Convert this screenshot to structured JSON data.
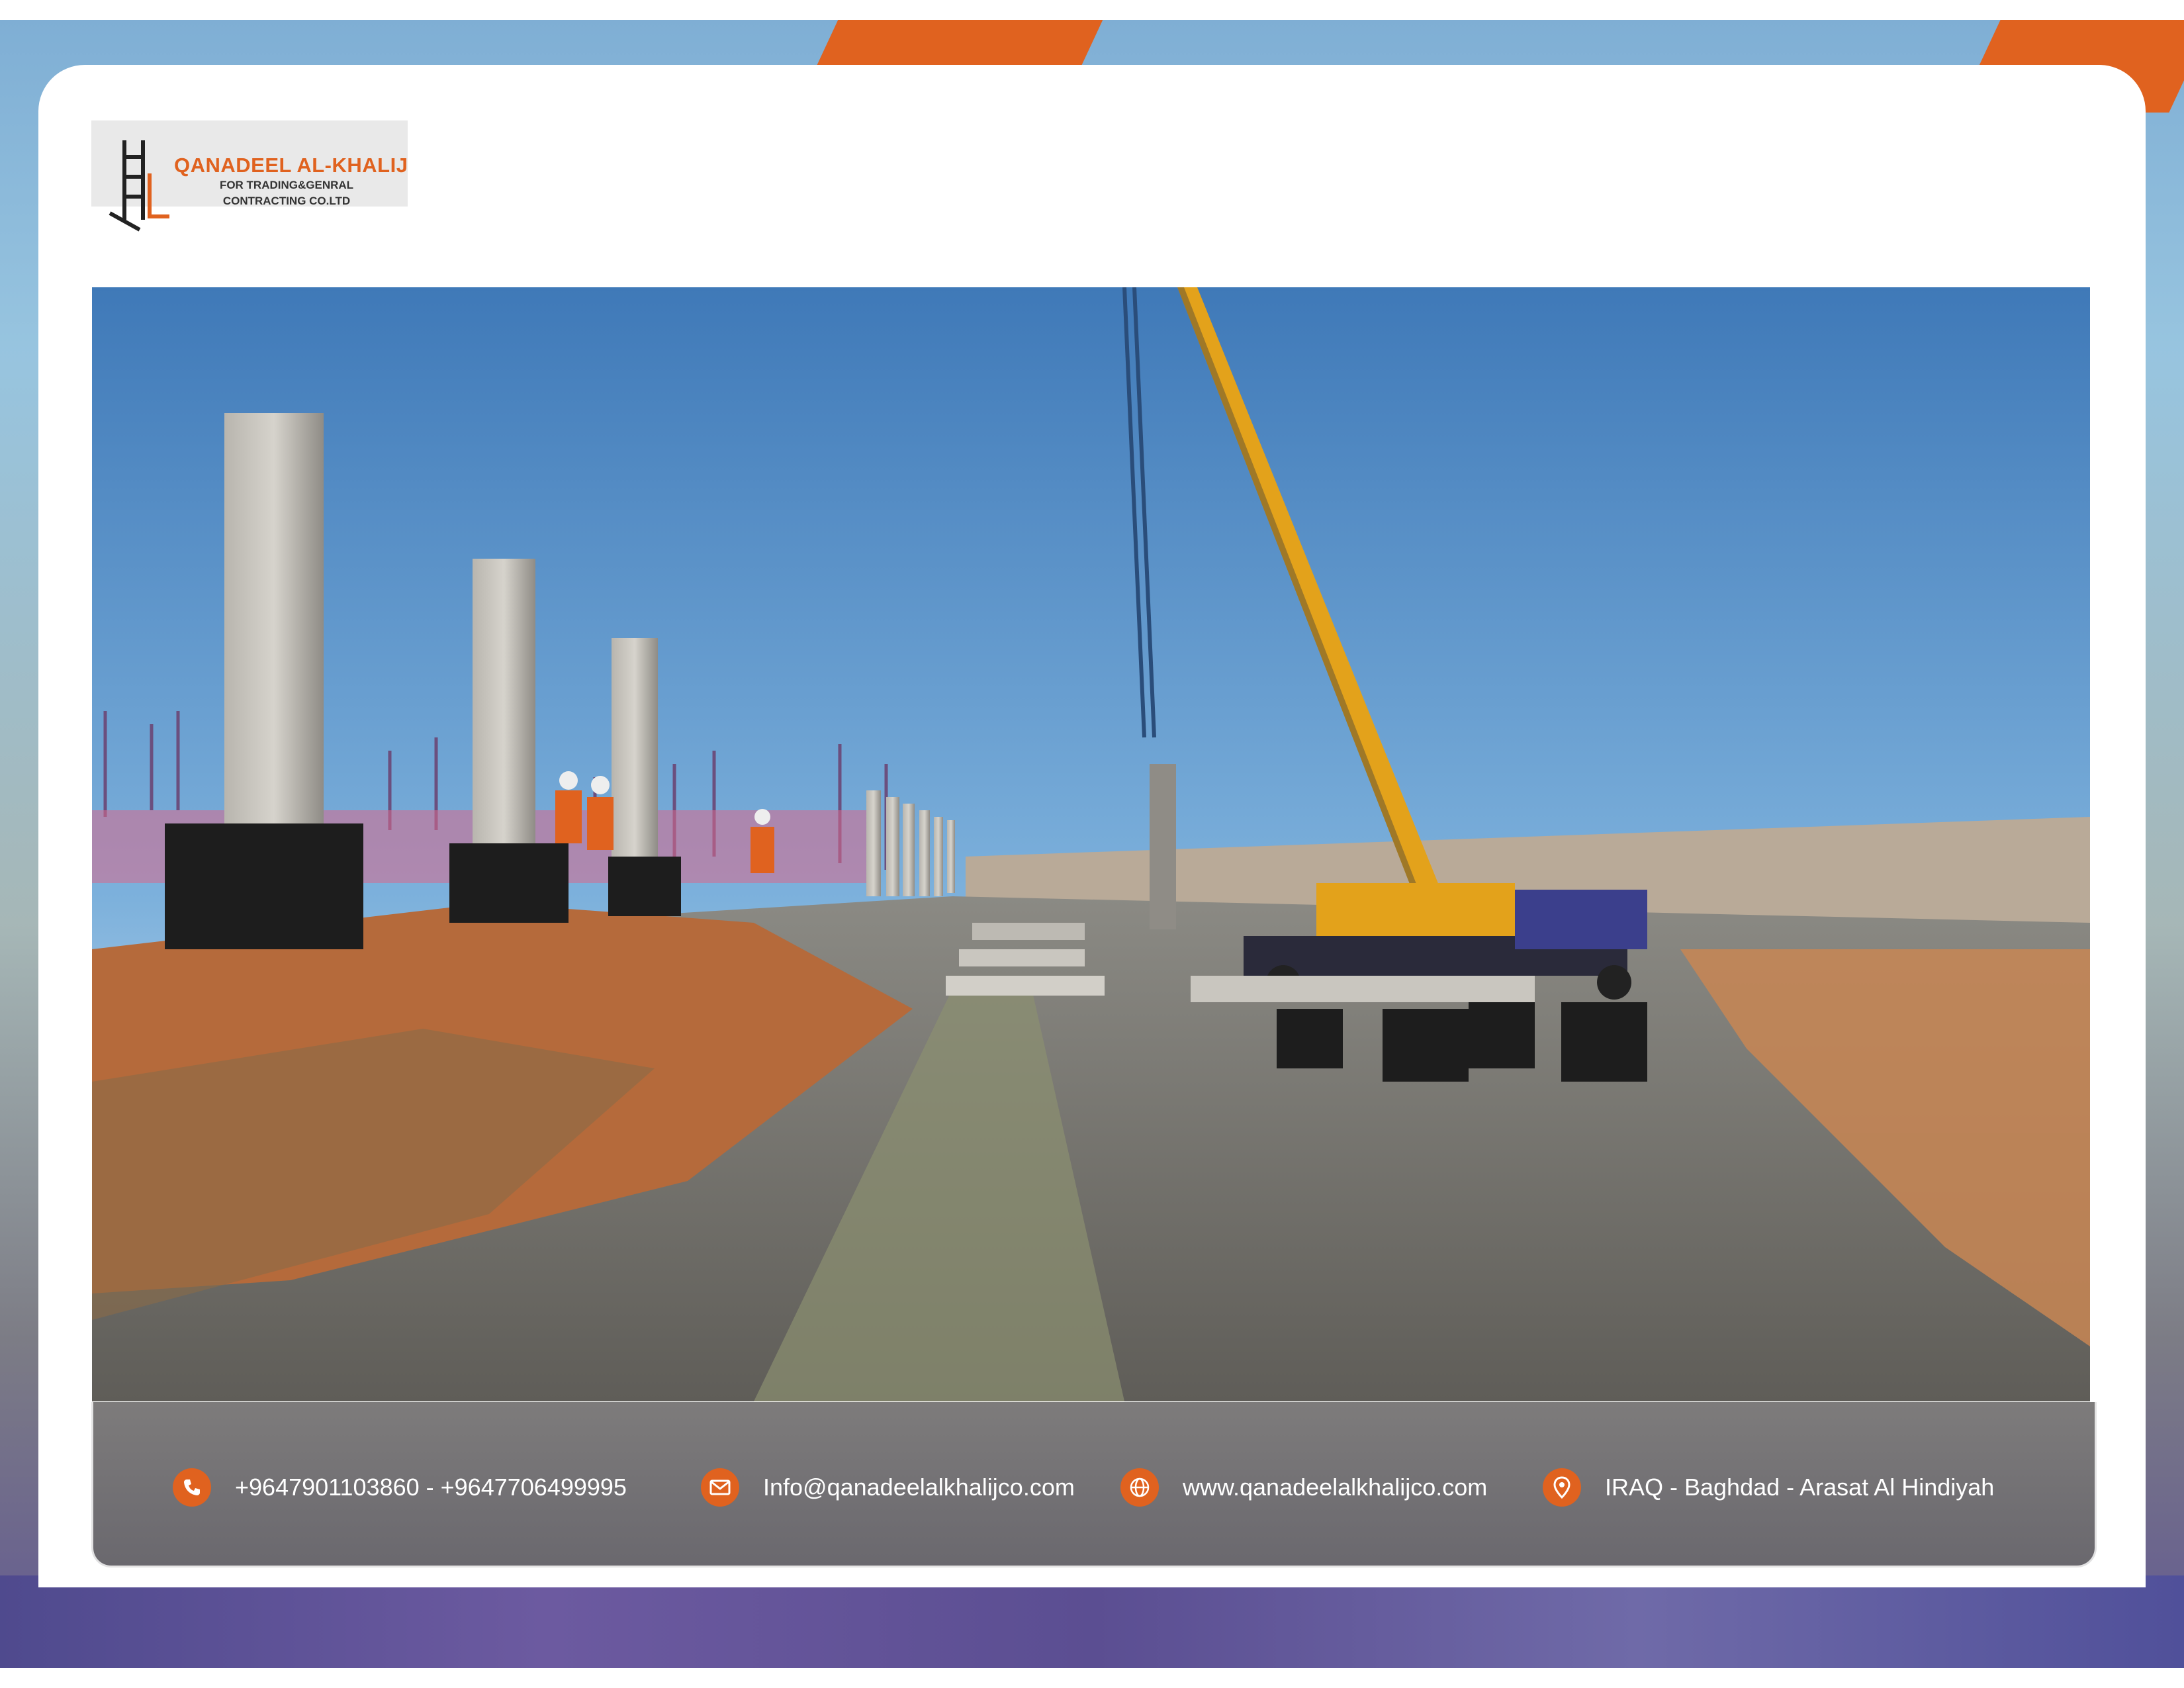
{
  "logo": {
    "title": "QANADEEL AL-KHALIJ",
    "subtitle_line1": "FOR TRADING&GENRAL",
    "subtitle_line2": "CONTRACTING CO.LTD"
  },
  "photo": {
    "subject": "construction-site-crane-precast-columns"
  },
  "contact": {
    "phone": "+9647901103860  -  +9647706499995",
    "email": "Info@qanadeelalkhalijco.com",
    "website": "www.qanadeelalkhalijco.com",
    "address": "IRAQ - Baghdad - Arasat Al Hindiyah"
  },
  "colors": {
    "accent": "#e0621f",
    "contact_bar": "#737173",
    "frame_bottom": "#5b4e92"
  },
  "icons": [
    "phone-icon",
    "email-icon",
    "globe-icon",
    "location-pin-icon"
  ]
}
